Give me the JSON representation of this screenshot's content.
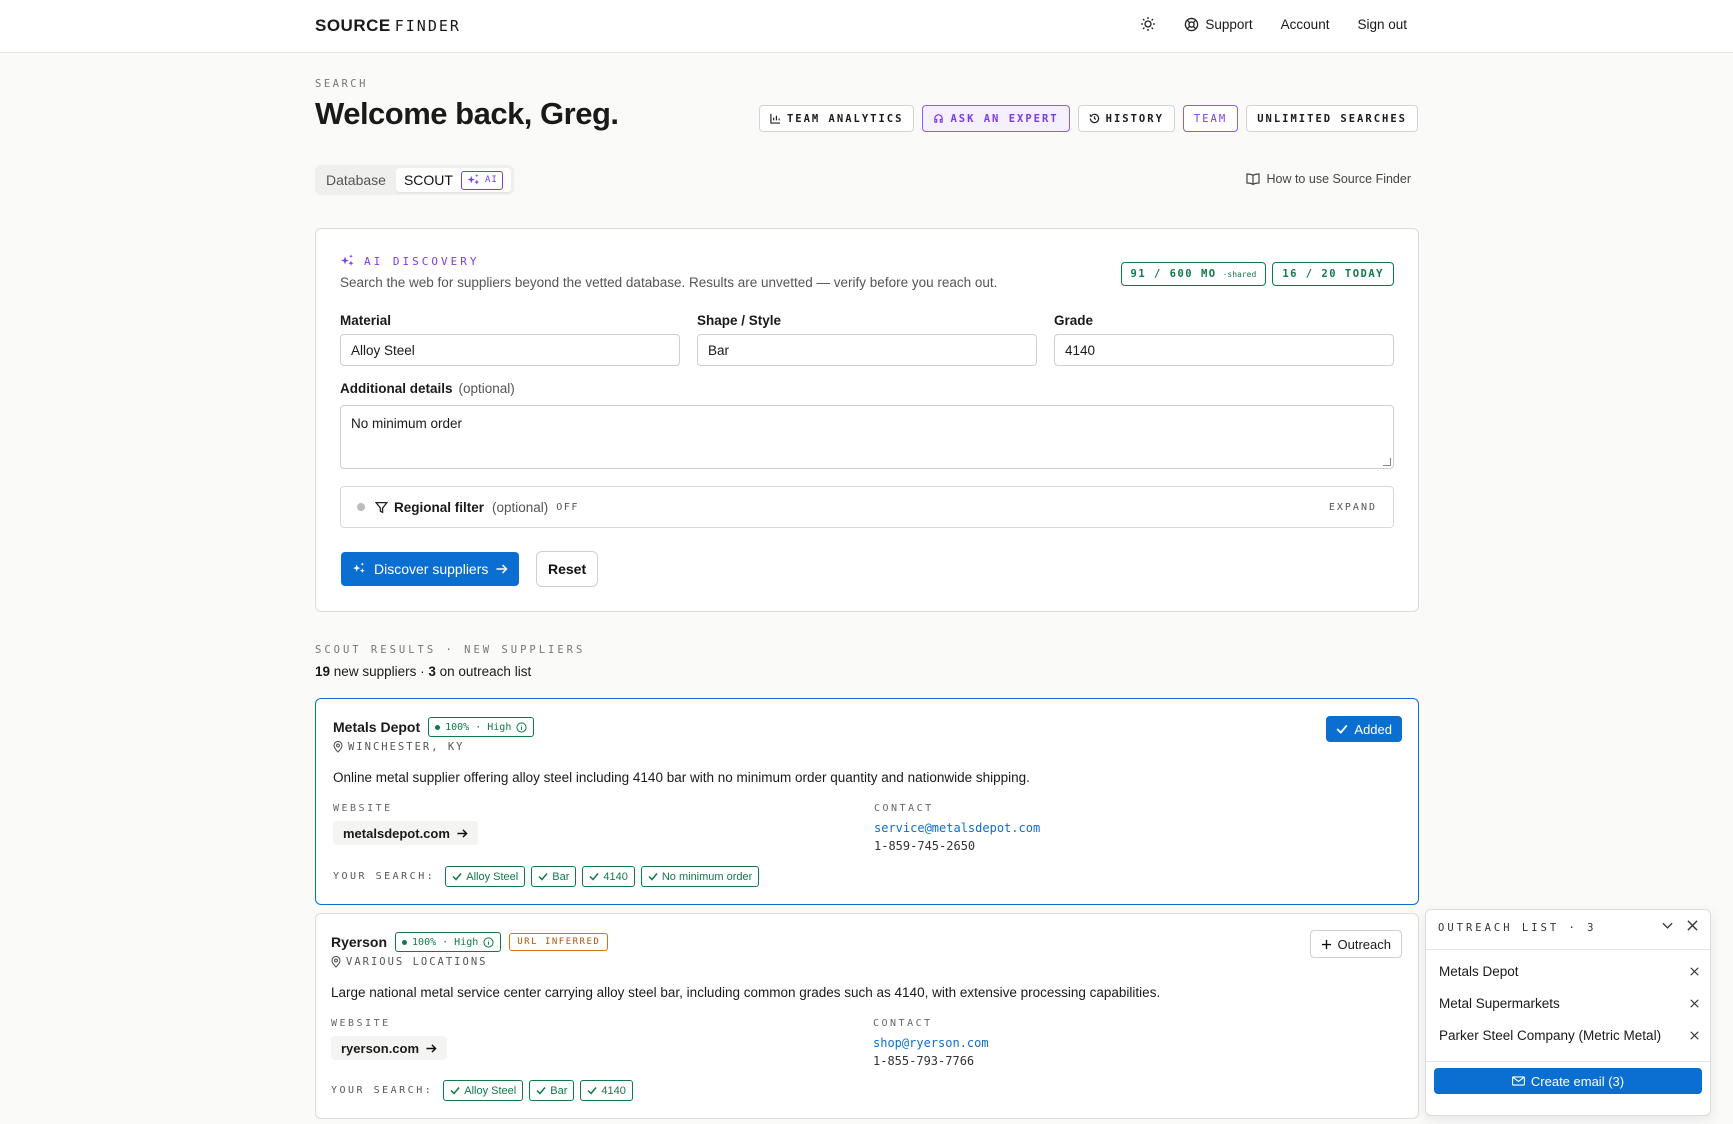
{
  "header": {
    "brand_bold": "SOURCE",
    "brand_light": "FINDER",
    "nav": {
      "support": "Support",
      "account": "Account",
      "signout": "Sign out"
    }
  },
  "page": {
    "eyebrow": "SEARCH",
    "title": "Welcome back, Greg.",
    "pills": {
      "analytics": "TEAM ANALYTICS",
      "expert": "ASK AN EXPERT",
      "history": "HISTORY",
      "team": "TEAM",
      "unlimited": "UNLIMITED SEARCHES"
    },
    "mode": {
      "database": "Database",
      "scout": "SCOUT",
      "ai": "AI"
    },
    "howto": "How to use Source Finder"
  },
  "discovery": {
    "label": "AI DISCOVERY",
    "description": "Search the web for suppliers beyond the vetted database. Results are unvetted — verify before you reach out.",
    "quota_month": "91 / 600 MO",
    "quota_month_note": "·shared",
    "quota_today": "16 / 20 TODAY",
    "material_label": "Material",
    "material_value": "Alloy Steel",
    "shape_label": "Shape / Style",
    "shape_value": "Bar",
    "grade_label": "Grade",
    "grade_value": "4140",
    "additional_label": "Additional details",
    "additional_optional": "(optional)",
    "additional_value": "No minimum order",
    "regional_label": "Regional filter",
    "regional_optional": "(optional)",
    "regional_state": "OFF",
    "regional_expand": "EXPAND",
    "discover_button": "Discover suppliers",
    "reset_button": "Reset"
  },
  "results": {
    "eyebrow": "SCOUT RESULTS · NEW SUPPLIERS",
    "count_new": "19",
    "count_new_text": "new suppliers ·",
    "count_list": "3",
    "count_list_text": "on outreach list",
    "website_label": "WEBSITE",
    "contact_label": "CONTACT",
    "your_search_label": "YOUR SEARCH:",
    "items": [
      {
        "name": "Metals Depot",
        "confidence": "100% · High",
        "location": "WINCHESTER, KY",
        "description": "Online metal supplier offering alloy steel including 4140 bar with no minimum order quantity and nationwide shipping.",
        "website": "metalsdepot.com",
        "email": "service@metalsdepot.com",
        "phone": "1-859-745-2650",
        "matches": [
          "Alloy Steel",
          "Bar",
          "4140",
          "No minimum order"
        ],
        "action": "Added"
      },
      {
        "name": "Ryerson",
        "confidence": "100% · High",
        "badge": "URL INFERRED",
        "location": "VARIOUS LOCATIONS",
        "description": "Large national metal service center carrying alloy steel bar, including common grades such as 4140, with extensive processing capabilities.",
        "website": "ryerson.com",
        "email": "shop@ryerson.com",
        "phone": "1-855-793-7766",
        "matches": [
          "Alloy Steel",
          "Bar",
          "4140"
        ],
        "action": "Outreach"
      }
    ]
  },
  "outreach": {
    "title": "OUTREACH LIST · 3",
    "items": [
      "Metals Depot",
      "Metal Supermarkets",
      "Parker Steel Company (Metric Metal)"
    ],
    "create_button": "Create email (3)"
  },
  "colors": {
    "primary": "#0b6fd1",
    "ai_purple": "#7c3aed",
    "match_green": "#0f7a4a",
    "inferred_orange": "#d97706"
  }
}
